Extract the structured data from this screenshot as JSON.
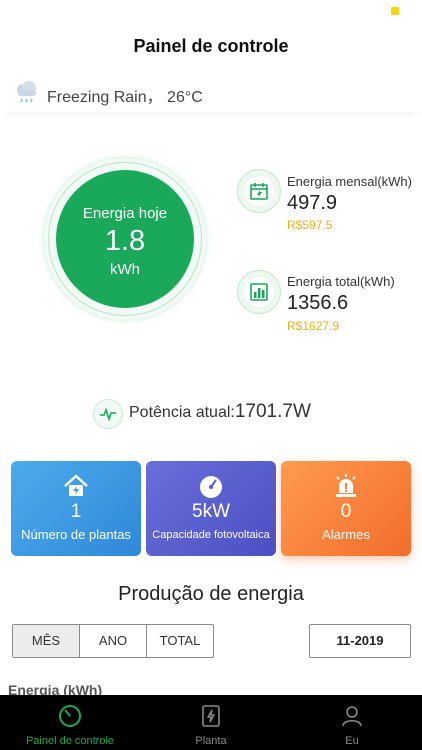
{
  "header": {
    "title": "Painel de controle"
  },
  "weather": {
    "text": "Freezing Rain，  26°C",
    "icon": "sleet-cloud-icon"
  },
  "today": {
    "label": "Energia hoje",
    "value": "1.8",
    "unit": "kWh"
  },
  "monthly": {
    "label": "Energia mensal(kWh)",
    "value": "497.9",
    "money": "R$597.5"
  },
  "total": {
    "label": "Energia total(kWh)",
    "value": "1356.6",
    "money": "R$1627.9"
  },
  "power": {
    "label": "Potência atual:",
    "value": "1701.7W"
  },
  "cards": [
    {
      "value": "1",
      "label": "Número de plantas",
      "icon": "home-icon",
      "color": "#3d9be4"
    },
    {
      "value": "5kW",
      "label": "Capacidade fotovoltaica",
      "icon": "gauge-icon",
      "color": "#5a5fcf"
    },
    {
      "value": "0",
      "label": "Alarmes",
      "icon": "alarm-icon",
      "color": "#f6833c"
    }
  ],
  "production": {
    "title": "Produção de energia",
    "tabs": [
      "MÊS",
      "ANO",
      "TOTAL"
    ],
    "active_tab": "MÊS",
    "date": "11-2019",
    "energy_label": "Energia (kWh)"
  },
  "tabbar": [
    {
      "label": "Painel de controle",
      "icon": "dashboard-icon",
      "active": true
    },
    {
      "label": "Planta",
      "icon": "plant-icon",
      "active": false
    },
    {
      "label": "Eu",
      "icon": "user-icon",
      "active": false
    }
  ],
  "colors": {
    "accent": "#1aa85a",
    "money": "#e8b11c",
    "background": "#ffffff",
    "tabbar": "#000000"
  }
}
